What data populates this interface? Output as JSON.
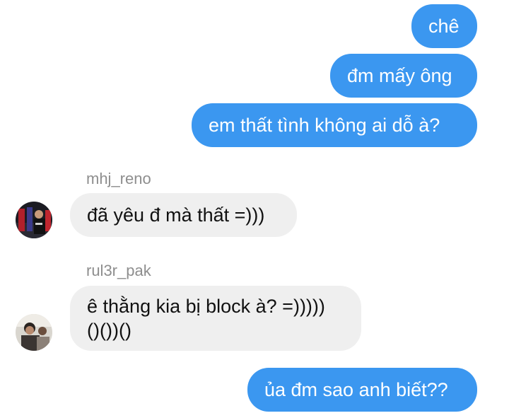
{
  "messages": {
    "out1": "chê",
    "out2": "đm mấy ông",
    "out3": "em thất tình không ai dỗ à?",
    "out4": "ủa đm sao anh biết??"
  },
  "senders": {
    "reno": {
      "username": "mhj_reno",
      "message": "đã yêu đ mà thất =)))",
      "avatar_icon": "person-avatar-icon"
    },
    "pak": {
      "username": "rul3r_pak",
      "message_line1": "ê thằng kia bị block à? =)))))",
      "message_line2": "()())()",
      "avatar_icon": "person-avatar-icon"
    }
  },
  "colors": {
    "outgoing_bubble": "#3b97f0",
    "incoming_bubble": "#efefef",
    "username_text": "#8e8e8e"
  }
}
